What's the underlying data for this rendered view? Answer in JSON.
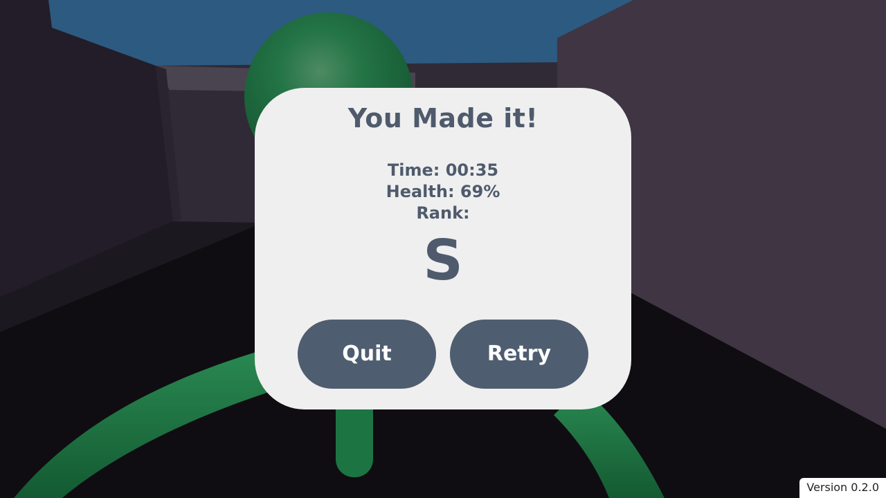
{
  "result": {
    "title": "You Made it!",
    "time_line": "Time: 00:35",
    "health_line": "Health: 69%",
    "rank_label": "Rank:",
    "rank": "S"
  },
  "buttons": {
    "quit": "Quit",
    "retry": "Retry"
  },
  "version": "Version 0.2.0",
  "colors": {
    "panel_bg": "#efefef",
    "text": "#4f5b6c",
    "button_bg": "#4f5d70",
    "button_text": "#ffffff",
    "sky": "#2f5b80",
    "character": "#1f6b40"
  }
}
